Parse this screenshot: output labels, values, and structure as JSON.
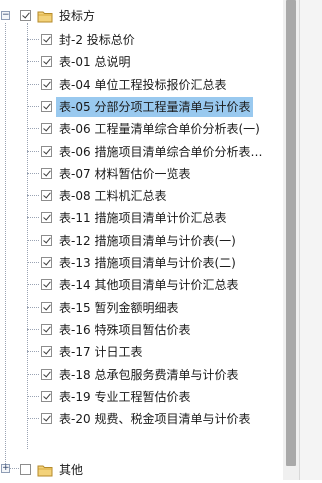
{
  "tree": {
    "root": {
      "label": "投标方",
      "checked": true,
      "expanded": true,
      "expander_glyph": "−",
      "icon": "folder-icon"
    },
    "items": [
      {
        "code": "封-2",
        "name": "投标总价",
        "checked": true,
        "selected": false
      },
      {
        "code": "表-01",
        "name": "总说明",
        "checked": true,
        "selected": false
      },
      {
        "code": "表-04",
        "name": "单位工程投标报价汇总表",
        "checked": true,
        "selected": false
      },
      {
        "code": "表-05",
        "name": "分部分项工程量清单与计价表",
        "checked": true,
        "selected": true
      },
      {
        "code": "表-06",
        "name": "工程量清单综合单价分析表(一)",
        "checked": true,
        "selected": false
      },
      {
        "code": "表-06",
        "name": "措施项目清单综合单价分析表…",
        "checked": true,
        "selected": false
      },
      {
        "code": "表-07",
        "name": "材料暂估价一览表",
        "checked": true,
        "selected": false
      },
      {
        "code": "表-08",
        "name": "工料机汇总表",
        "checked": true,
        "selected": false
      },
      {
        "code": "表-11",
        "name": "措施项目清单计价汇总表",
        "checked": true,
        "selected": false
      },
      {
        "code": "表-12",
        "name": "措施项目清单与计价表(一)",
        "checked": true,
        "selected": false
      },
      {
        "code": "表-13",
        "name": "措施项目清单与计价表(二)",
        "checked": true,
        "selected": false
      },
      {
        "code": "表-14",
        "name": "其他项目清单与计价汇总表",
        "checked": true,
        "selected": false
      },
      {
        "code": "表-15",
        "name": "暂列金额明细表",
        "checked": true,
        "selected": false
      },
      {
        "code": "表-16",
        "name": "特殊项目暂估价表",
        "checked": true,
        "selected": false
      },
      {
        "code": "表-17",
        "name": "计日工表",
        "checked": true,
        "selected": false
      },
      {
        "code": "表-18",
        "name": "总承包服务费清单与计价表",
        "checked": true,
        "selected": false
      },
      {
        "code": "表-19",
        "name": "专业工程暂估价表",
        "checked": true,
        "selected": false
      },
      {
        "code": "表-20",
        "name": "规费、税金项目清单与计价表",
        "checked": true,
        "selected": false
      }
    ],
    "other": {
      "label": "其他",
      "checked": false,
      "expanded": false,
      "expander_glyph": "+",
      "icon": "folder-icon"
    }
  },
  "colors": {
    "selection": "#99c9ef",
    "tree_lines": "#9aa3b3",
    "folder_body": "#f3d27a",
    "folder_outline": "#b48a2a",
    "scrollbar_thumb": "#a9a9a9"
  }
}
